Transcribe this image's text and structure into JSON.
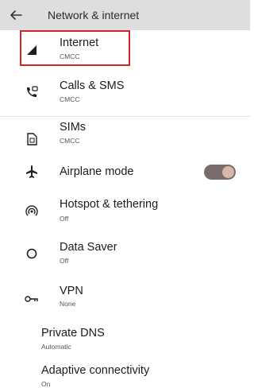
{
  "header": {
    "title": "Network & internet"
  },
  "items": {
    "internet": {
      "label": "Internet",
      "sub": "CMCC"
    },
    "calls": {
      "label": "Calls & SMS",
      "sub": "CMCC"
    },
    "sims": {
      "label": "SIMs",
      "sub": "CMCC"
    },
    "airplane": {
      "label": "Airplane mode",
      "toggle_on": false
    },
    "hotspot": {
      "label": "Hotspot & tethering",
      "sub": "Off"
    },
    "datasaver": {
      "label": "Data Saver",
      "sub": "Off"
    },
    "vpn": {
      "label": "VPN",
      "sub": "None"
    },
    "private_dns": {
      "label": "Private DNS",
      "sub": "Automatic"
    },
    "adaptive": {
      "label": "Adaptive connectivity",
      "sub": "On"
    }
  },
  "colors": {
    "highlight": "#d6232a",
    "toggle_track": "#7a6c6a",
    "toggle_knob": "#d6b8aa"
  },
  "icons": [
    "back-arrow-icon",
    "signal-icon",
    "calls-sms-icon",
    "sim-icon",
    "airplane-icon",
    "hotspot-icon",
    "data-saver-icon",
    "vpn-key-icon"
  ]
}
